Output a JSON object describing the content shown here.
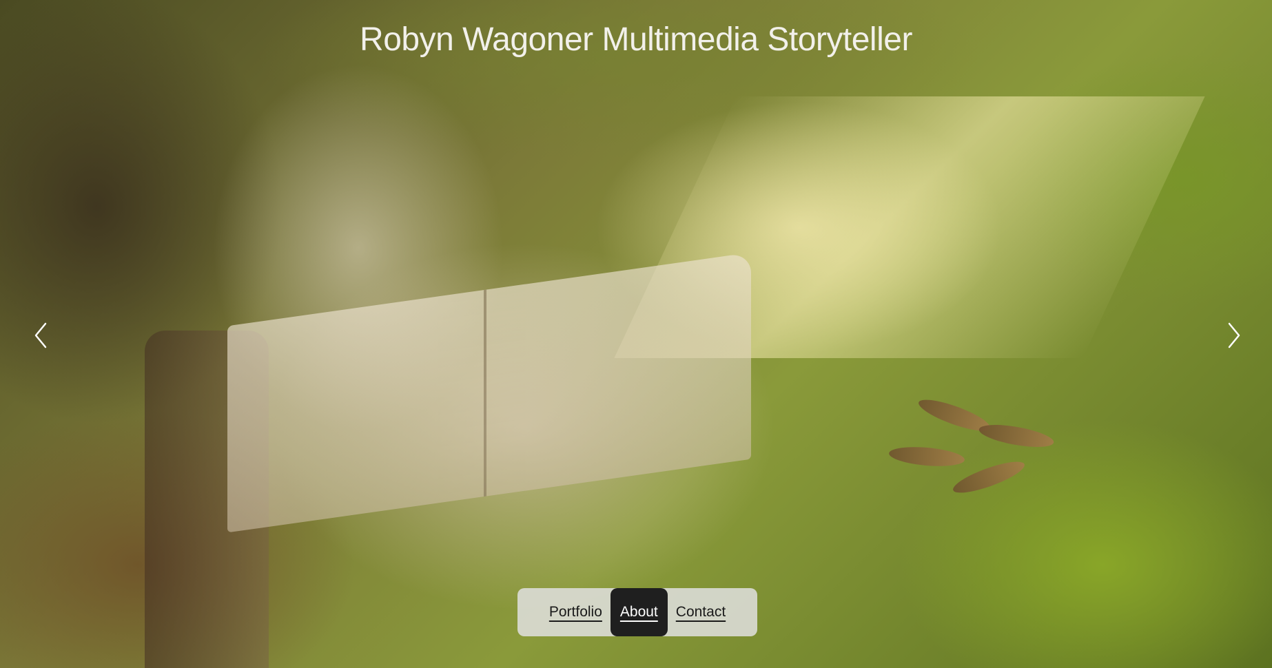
{
  "header": {
    "site_title": "Robyn Wagoner Multimedia Storyteller"
  },
  "slideshow": {
    "prev_icon": "chevron-left-icon",
    "next_icon": "chevron-right-icon"
  },
  "nav": {
    "items": [
      {
        "label": "Portfolio",
        "active": false
      },
      {
        "label": "About",
        "active": true
      },
      {
        "label": "Contact",
        "active": false
      }
    ]
  },
  "colors": {
    "title_text": "#f2f0ea",
    "nav_bg": "#e1e1e1",
    "nav_active_bg": "#1f1f1f",
    "nav_text": "#1a1a1a"
  }
}
